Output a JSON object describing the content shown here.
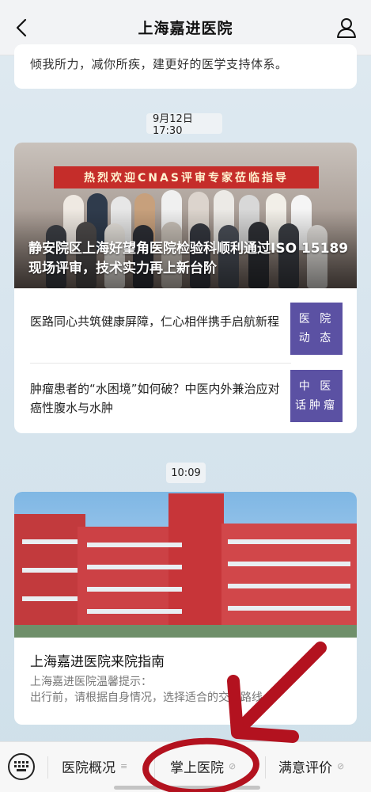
{
  "header": {
    "title": "上海嘉进医院"
  },
  "feed": {
    "prev_card_text": "倾我所力，减你所疾，建更好的医学支持体系。",
    "groups": [
      {
        "time": "9月12日 17:30",
        "banner_text": "热烈欢迎CNAS评审专家莅临指导",
        "headline": "静安院区上海好望角医院检验科顺利通过ISO 15189现场评审，技术实力再上新台阶",
        "items": [
          {
            "text": "医路同心共筑健康屏障，仁心相伴携手启航新程",
            "thumb_line1": "医 院",
            "thumb_line2": "动 态"
          },
          {
            "text": "肿瘤患者的“水困境”如何破？中医内外兼治应对癌性腹水与水肿",
            "thumb_line1": "中 医",
            "thumb_line2": "话肿瘤"
          }
        ]
      },
      {
        "time": "10:09",
        "title": "上海嘉进医院来院指南",
        "desc_line1": "上海嘉进医院温馨提示：",
        "desc_line2": "出行前，请根据自身情况，选择适合的交通路线。"
      }
    ]
  },
  "bottom_menu": {
    "items": [
      {
        "label": "医院概况",
        "icon": "menu-lines-icon"
      },
      {
        "label": "掌上医院",
        "icon": "link-icon"
      },
      {
        "label": "满意评价",
        "icon": "link-icon"
      }
    ]
  },
  "colors": {
    "accent_red": "#b3121f",
    "thumb_purple": "#5b51a3"
  }
}
